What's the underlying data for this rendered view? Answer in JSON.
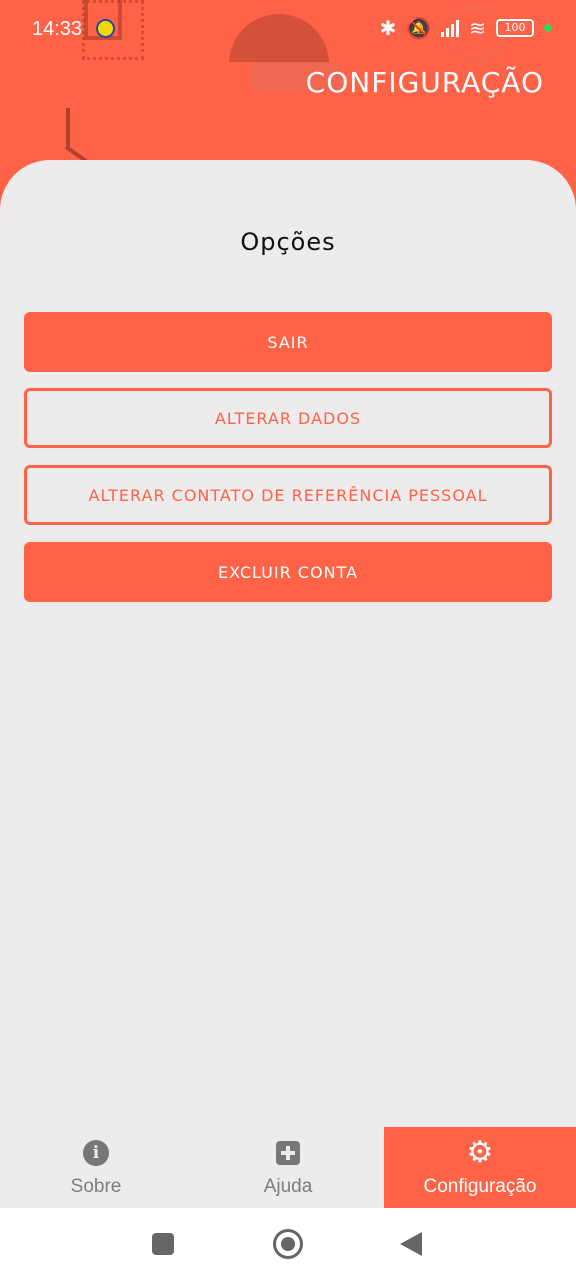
{
  "status_bar": {
    "time": "14:33",
    "battery": "100"
  },
  "header": {
    "title": "CONFIGURAÇÃO"
  },
  "options": {
    "title": "Opções",
    "buttons": [
      {
        "label": "SAIR",
        "style": "filled"
      },
      {
        "label": "ALTERAR DADOS",
        "style": "outlined"
      },
      {
        "label": "ALTERAR CONTATO DE REFERÊNCIA PESSOAL",
        "style": "outlined"
      },
      {
        "label": "EXCLUIR CONTA",
        "style": "filled"
      }
    ]
  },
  "bottom_nav": {
    "items": [
      {
        "label": "Sobre",
        "icon": "info-icon"
      },
      {
        "label": "Ajuda",
        "icon": "plus-box-icon"
      },
      {
        "label": "Configuração",
        "icon": "gear-icon",
        "active": true
      }
    ]
  },
  "colors": {
    "accent": "#ff6347",
    "background": "#edebec",
    "inactive": "#7d7d7d"
  }
}
